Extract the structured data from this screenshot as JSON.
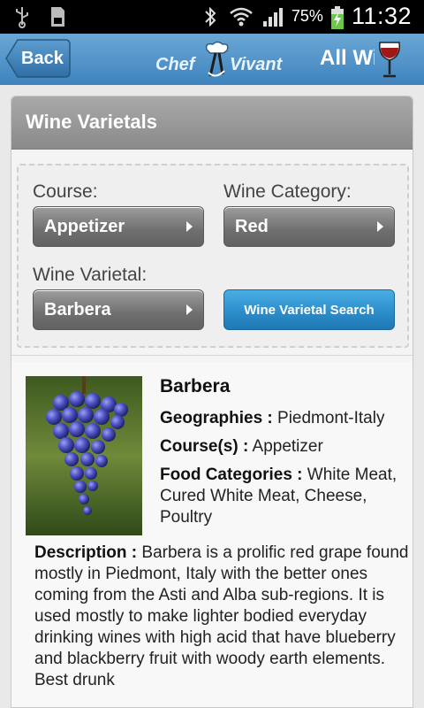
{
  "status_bar": {
    "battery_percent": "75%",
    "time": "11:32",
    "icons": [
      "usb-icon",
      "sd-card-icon",
      "bluetooth-icon",
      "wifi-icon",
      "signal-icon",
      "battery-charging-icon"
    ]
  },
  "header": {
    "back_label": "Back",
    "brand_left": "Chef",
    "brand_right": "Vivant",
    "all_wines_label": "All Wi",
    "icon": "wine-glass-icon"
  },
  "panel": {
    "title": "Wine Varietals",
    "course_label": "Course:",
    "course_value": "Appetizer",
    "category_label": "Wine Category:",
    "category_value": "Red",
    "varietal_label": "Wine Varietal:",
    "varietal_value": "Barbera",
    "search_button": "Wine Varietal Search"
  },
  "result": {
    "name": "Barbera",
    "geographies_label": "Geographies :",
    "geographies_value": "Piedmont-Italy",
    "courses_label": "Course(s) :",
    "courses_value": "Appetizer",
    "food_label": "Food Categories :",
    "food_value": "White Meat, Cured White Meat, Cheese, Poultry",
    "description_label": "Description  :",
    "description_value": "Barbera is a prolific red grape found mostly in Piedmont, Italy with the better ones coming from the Asti and Alba sub-regions. It is used mostly to make lighter bodied everyday drinking wines with high acid that have blueberry and blackberry fruit with woody earth elements. Best drunk"
  },
  "colors": {
    "header_blue": "#4d91c6",
    "search_blue": "#2a8bc9",
    "grape_purple": "#4b4fc2"
  }
}
